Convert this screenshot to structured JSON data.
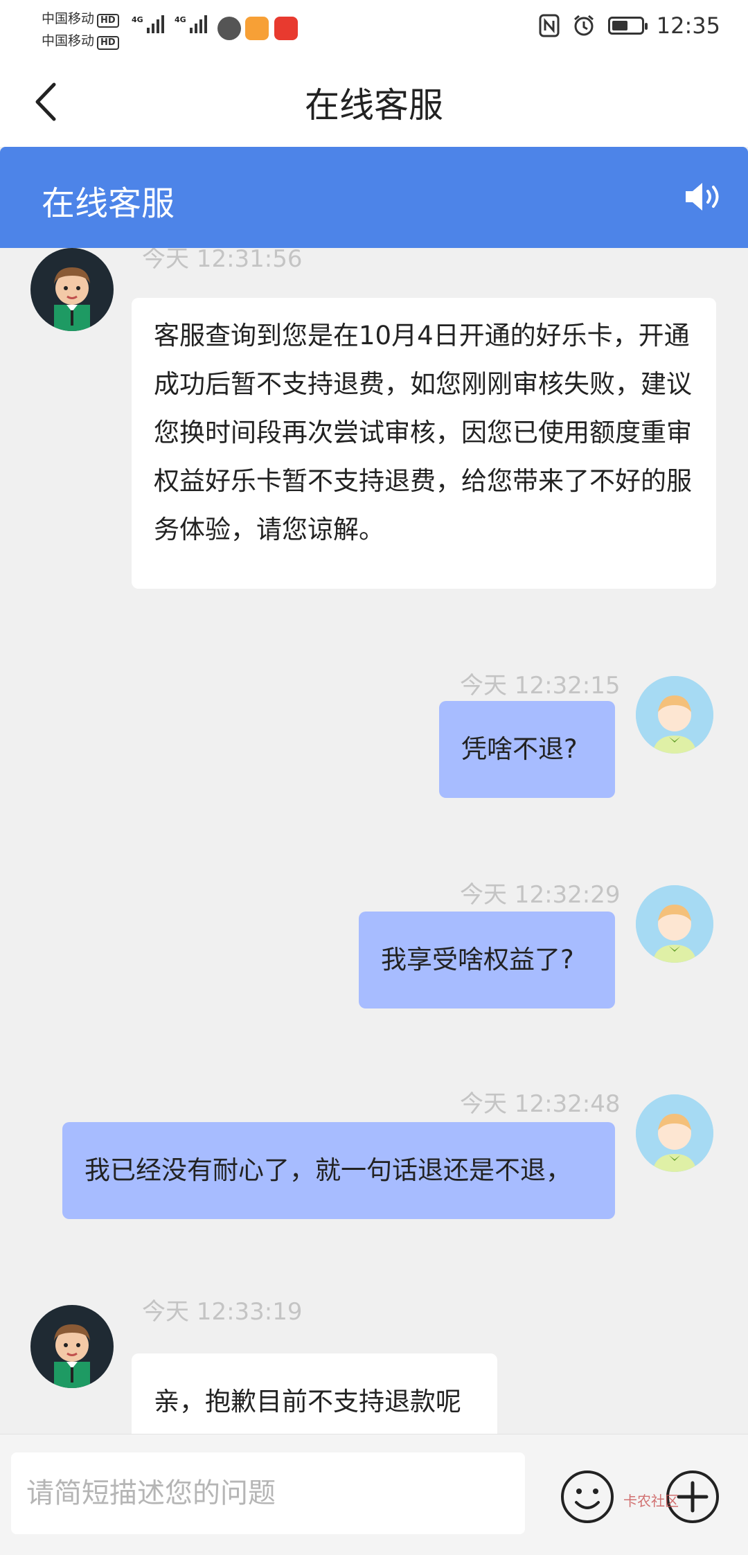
{
  "status_bar": {
    "carrier1": "中国移动",
    "carrier2": "中国移动",
    "hd": "HD",
    "network": "4G",
    "time": "12:35",
    "battery_level": 0.55,
    "icons": [
      "nfc-icon",
      "alarm-icon",
      "battery-icon"
    ]
  },
  "header": {
    "back_icon": "chevron-left-icon",
    "title": "在线客服"
  },
  "chat_header": {
    "title": "在线客服",
    "speaker_icon": "speaker-icon",
    "accent": "#4d84e8"
  },
  "messages": [
    {
      "from": "agent",
      "time": "今天 12:31:56",
      "text": "客服查询到您是在10月4日开通的好乐卡，开通成功后暂不支持退费，如您刚刚审核失败，建议您换时间段再次尝试审核，因您已使用额度重审权益好乐卡暂不支持退费，给您带来了不好的服务体验，请您谅解。"
    },
    {
      "from": "user",
      "time": "今天 12:32:15",
      "text": "凭啥不退?"
    },
    {
      "from": "user",
      "time": "今天 12:32:29",
      "text": "我享受啥权益了?"
    },
    {
      "from": "user",
      "time": "今天 12:32:48",
      "text": "我已经没有耐心了，就一句话退还是不退，"
    },
    {
      "from": "agent",
      "time": "今天 12:33:19",
      "text": "亲，抱歉目前不支持退款呢"
    }
  ],
  "input_bar": {
    "placeholder": "请简短描述您的问题",
    "emoji_icon": "emoji-icon",
    "plus_icon": "plus-icon",
    "watermark": "卡农社区"
  },
  "colors": {
    "user_bubble": "#a7bcff",
    "agent_bubble": "#ffffff",
    "background": "#f0f0f0"
  }
}
